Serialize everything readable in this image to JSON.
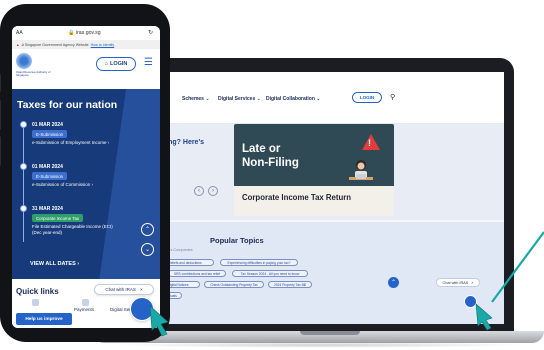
{
  "laptop": {
    "nav": {
      "items": [
        "Schemes",
        "Digital Services",
        "Digital Collaboration"
      ],
      "login": "LOGIN"
    },
    "hero": {
      "left_text": "Filing? Here's",
      "banner_title_line1": "Late or",
      "banner_title_line2": "Non-Filing",
      "banner_subtitle": "Corporate Income Tax Return"
    },
    "popular": {
      "title": "Popular Topics",
      "tabs": "Partners    Companies",
      "chips": [
        "Reliefs and deductions",
        "Experiencing difficulties in paying your tax?",
        "SRS contributions and tax relief",
        "Tax Season 2024 - All you need to know",
        "Digital Notices",
        "Check Outstanding Property Tax",
        "2024 Property Tax Bill",
        "Individuals"
      ],
      "chat_label": "Chat with IRAS",
      "chat_close": "×"
    }
  },
  "phone": {
    "status": {
      "aa": "AA",
      "url": "iras.gov.sg"
    },
    "gov_banner": {
      "text": "A Singapore Government Agency Website",
      "link": "How to identify"
    },
    "header": {
      "login": "LOGIN",
      "logo_text": "Inland Revenue Authority of Singapore"
    },
    "taxes": {
      "title": "Taxes for our nation",
      "entries": [
        {
          "date": "01 MAR 2024",
          "tag": "E-Submission",
          "desc": [
            "e-Submission of Employment Income"
          ],
          "tag_color": "blue"
        },
        {
          "date": "01 MAR 2024",
          "tag": "E-Submission",
          "desc": [
            "e-Submission of Commission"
          ],
          "tag_color": "blue"
        },
        {
          "date": "31 MAR 2024",
          "tag": "Corporate Income Tax",
          "desc": [
            "File Estimated Chargeable Income (ECI)",
            "(Dec year-end)"
          ],
          "tag_color": "green"
        }
      ],
      "view_all": "VIEW ALL DATES"
    },
    "quick_links": {
      "title": "Quick links",
      "chat_label": "Chat with IRAS",
      "chat_close": "×",
      "items": [
        "Payments",
        "Digital Services"
      ],
      "help": "Help us improve"
    }
  },
  "colors": {
    "brand_blue": "#2563c9",
    "navy": "#173b7a",
    "arrow_teal": "#1aa8a8"
  },
  "icons": [
    "search-icon",
    "menu-icon",
    "chevron-right-icon",
    "chevron-up-icon",
    "chevron-down-icon",
    "chat-icon",
    "cursor-arrow-icon",
    "warning-icon"
  ]
}
